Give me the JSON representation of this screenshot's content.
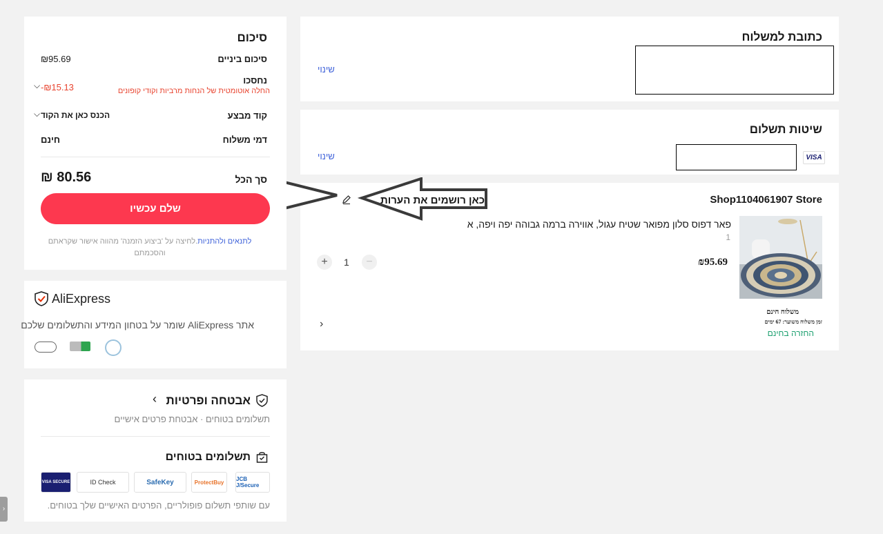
{
  "shipping": {
    "title": "כתובת למשלוח",
    "change": "שינוי"
  },
  "payment_methods": {
    "title": "שיטות תשלום",
    "change": "שינוי",
    "card_brand": "VISA"
  },
  "store": {
    "name": "Shop1104061907 Store",
    "annotation": "כאן רושמים את הערות",
    "product_title": "פאר דפוס סלון מפואר שטיח עגול, אווירה ברמה גבוהה יפה ויפה, א",
    "variant": "1",
    "price": "₪95.69",
    "quantity": "1",
    "shipping_free": "משלוח חינם",
    "delivery_time": "זמן משלוח משוער: 67 ימים",
    "free_return": "החזרה בחינם"
  },
  "summary": {
    "title": "סיכום",
    "subtotal_label": "סיכום ביניים",
    "subtotal_value": "₪95.69",
    "saved_label": "נחסכו",
    "saved_note": "החלה אוטומטית של הנחות מרביות וקודי קופונים",
    "saved_value": "-₪15.13",
    "promo_label": "קוד מבצע",
    "promo_placeholder": "הכנס כאן את הקוד",
    "shipping_label": "דמי משלוח",
    "shipping_value": "חינם",
    "total_label": "סך הכל",
    "total_value": "₪ 80.56",
    "pay_button": "שלם עכשיו",
    "terms_link": "לתנאים ולהתניות",
    "terms_text": ".לחיצה על 'ביצוע הזמנה' מהווה אישור שקראתם והסכמתם"
  },
  "aliexpress": {
    "logo": "AliExpress",
    "description": "אתר AliExpress שומר על בטחון המידע והתשלומים שלכם"
  },
  "security": {
    "title": "אבטחה ופרטיות",
    "subtitle": "תשלומים בטוחים · אבטחת פרטים אישיים",
    "safe_title": "תשלומים בטוחים",
    "badges": [
      "VISA SECURE",
      "ID Check",
      "SafeKey",
      "ProtectBuy",
      "JCB J/Secure"
    ],
    "footer": "עם שותפי תשלום פופולריים, הפרטים האישיים שלך בטוחים."
  },
  "colors": {
    "accent_red": "#fd384f",
    "saved_red": "#e8432e",
    "link_blue": "#3b5fd9",
    "return_green": "#1a9f6e"
  }
}
